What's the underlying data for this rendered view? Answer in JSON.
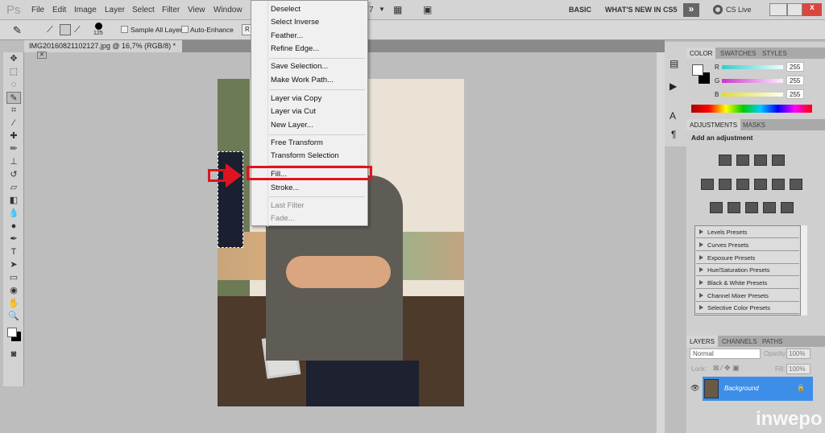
{
  "app": {
    "logo": "Ps",
    "menus": [
      "File",
      "Edit",
      "Image",
      "Layer",
      "Select",
      "Filter",
      "View",
      "Window"
    ],
    "workspaces": [
      "BASIC",
      "WHAT'S NEW IN CS5"
    ],
    "cs_live": "CS Live",
    "zoom_partial": "7"
  },
  "options": {
    "brush_size": "125",
    "sample_all_layers": "Sample All Layers",
    "auto_enhance": "Auto-Enhance",
    "refine_partial": "R"
  },
  "document": {
    "tab_title": "IMG20160821102127.jpg @ 16,7% (RGB/8) *"
  },
  "context_menu": {
    "items": [
      "Deselect",
      "Select Inverse",
      "Feather...",
      "Refine Edge...",
      "Save Selection...",
      "Make Work Path...",
      "Layer via Copy",
      "Layer via Cut",
      "New Layer...",
      "Free Transform",
      "Transform Selection",
      "Fill...",
      "Stroke...",
      "Last Filter",
      "Fade..."
    ],
    "highlighted": "Fill...",
    "highlight_color": "#e0141e"
  },
  "color_panel": {
    "tabs": [
      "COLOR",
      "SWATCHES",
      "STYLES"
    ],
    "r_label": "R",
    "g_label": "G",
    "b_label": "B",
    "r": "255",
    "g": "255",
    "b": "255"
  },
  "adjustments": {
    "tabs": [
      "ADJUSTMENTS",
      "MASKS"
    ],
    "heading": "Add an adjustment",
    "presets": [
      "Levels Presets",
      "Curves Presets",
      "Exposure Presets",
      "Hue/Saturation Presets",
      "Black & White Presets",
      "Channel Mixer Presets",
      "Selective Color Presets"
    ]
  },
  "layers": {
    "tabs": [
      "LAYERS",
      "CHANNELS",
      "PATHS"
    ],
    "blend_mode": "Normal",
    "opacity_label": "Opacity:",
    "opacity": "100%",
    "lock_label": "Lock:",
    "fill_label": "Fill:",
    "fill": "100%",
    "layer_name": "Background",
    "selected_color": "#3d8ee8"
  },
  "watermark": "inwepo"
}
